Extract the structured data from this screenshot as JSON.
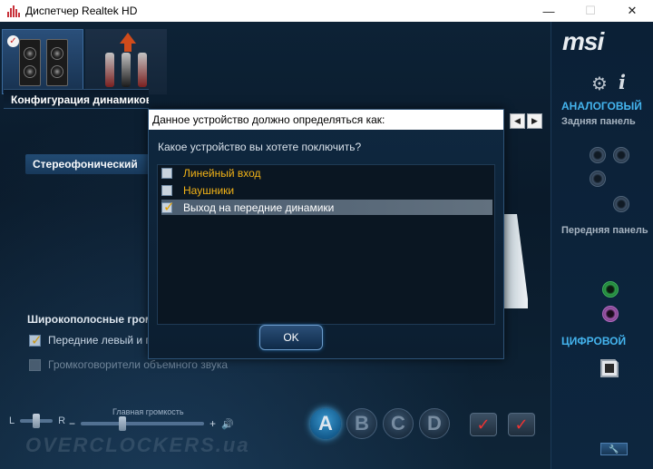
{
  "window": {
    "title": "Диспетчер Realtek HD",
    "minimize_glyph": "—",
    "maximize_glyph": "☐",
    "close_glyph": "✕"
  },
  "main": {
    "section_header": "Конфигурация динамиков",
    "speaker_config_value": "Стереофонический",
    "fullrange_heading": "Широкополосные громкоговорители",
    "front_lr_label": "Передние левый и правый",
    "front_lr_checked": true,
    "surround_label": "Громкоговорители объемного звука",
    "surround_checked": false,
    "surround_enabled": false
  },
  "bottom": {
    "balance_left": "L",
    "balance_right": "R",
    "master_volume_label": "Главная громкость",
    "minus": "−",
    "plus": "+",
    "volume_glyph": "🔊",
    "profile_buttons": [
      "A",
      "B",
      "C",
      "D"
    ],
    "active_profile": "A",
    "watermark": "OVERCLOCKERS.ua"
  },
  "right_panel": {
    "logo": "msi",
    "analog_heading": "АНАЛОГОВЫЙ",
    "rear_panel_label": "Задняя панель",
    "front_panel_label": "Передняя панель",
    "digital_heading": "ЦИФРОВОЙ",
    "wrench_glyph": "🔧"
  },
  "dialog": {
    "title": "Данное устройство должно определяться как:",
    "question": "Какое устройство вы хотете поключить?",
    "options": [
      {
        "label": "Линейный вход",
        "checked": false,
        "selected": false
      },
      {
        "label": "Наушники",
        "checked": false,
        "selected": false
      },
      {
        "label": "Выход на передние динамики",
        "checked": true,
        "selected": true
      }
    ],
    "ok_label": "OK"
  },
  "nav_arrows": {
    "left": "◀",
    "right": "▶"
  },
  "colors": {
    "accent_blue": "#44b4ee",
    "option_yellow": "#f3b317",
    "jack_green": "#2da04a",
    "jack_purple": "#a25ab0",
    "check_orange": "#e5a000"
  }
}
